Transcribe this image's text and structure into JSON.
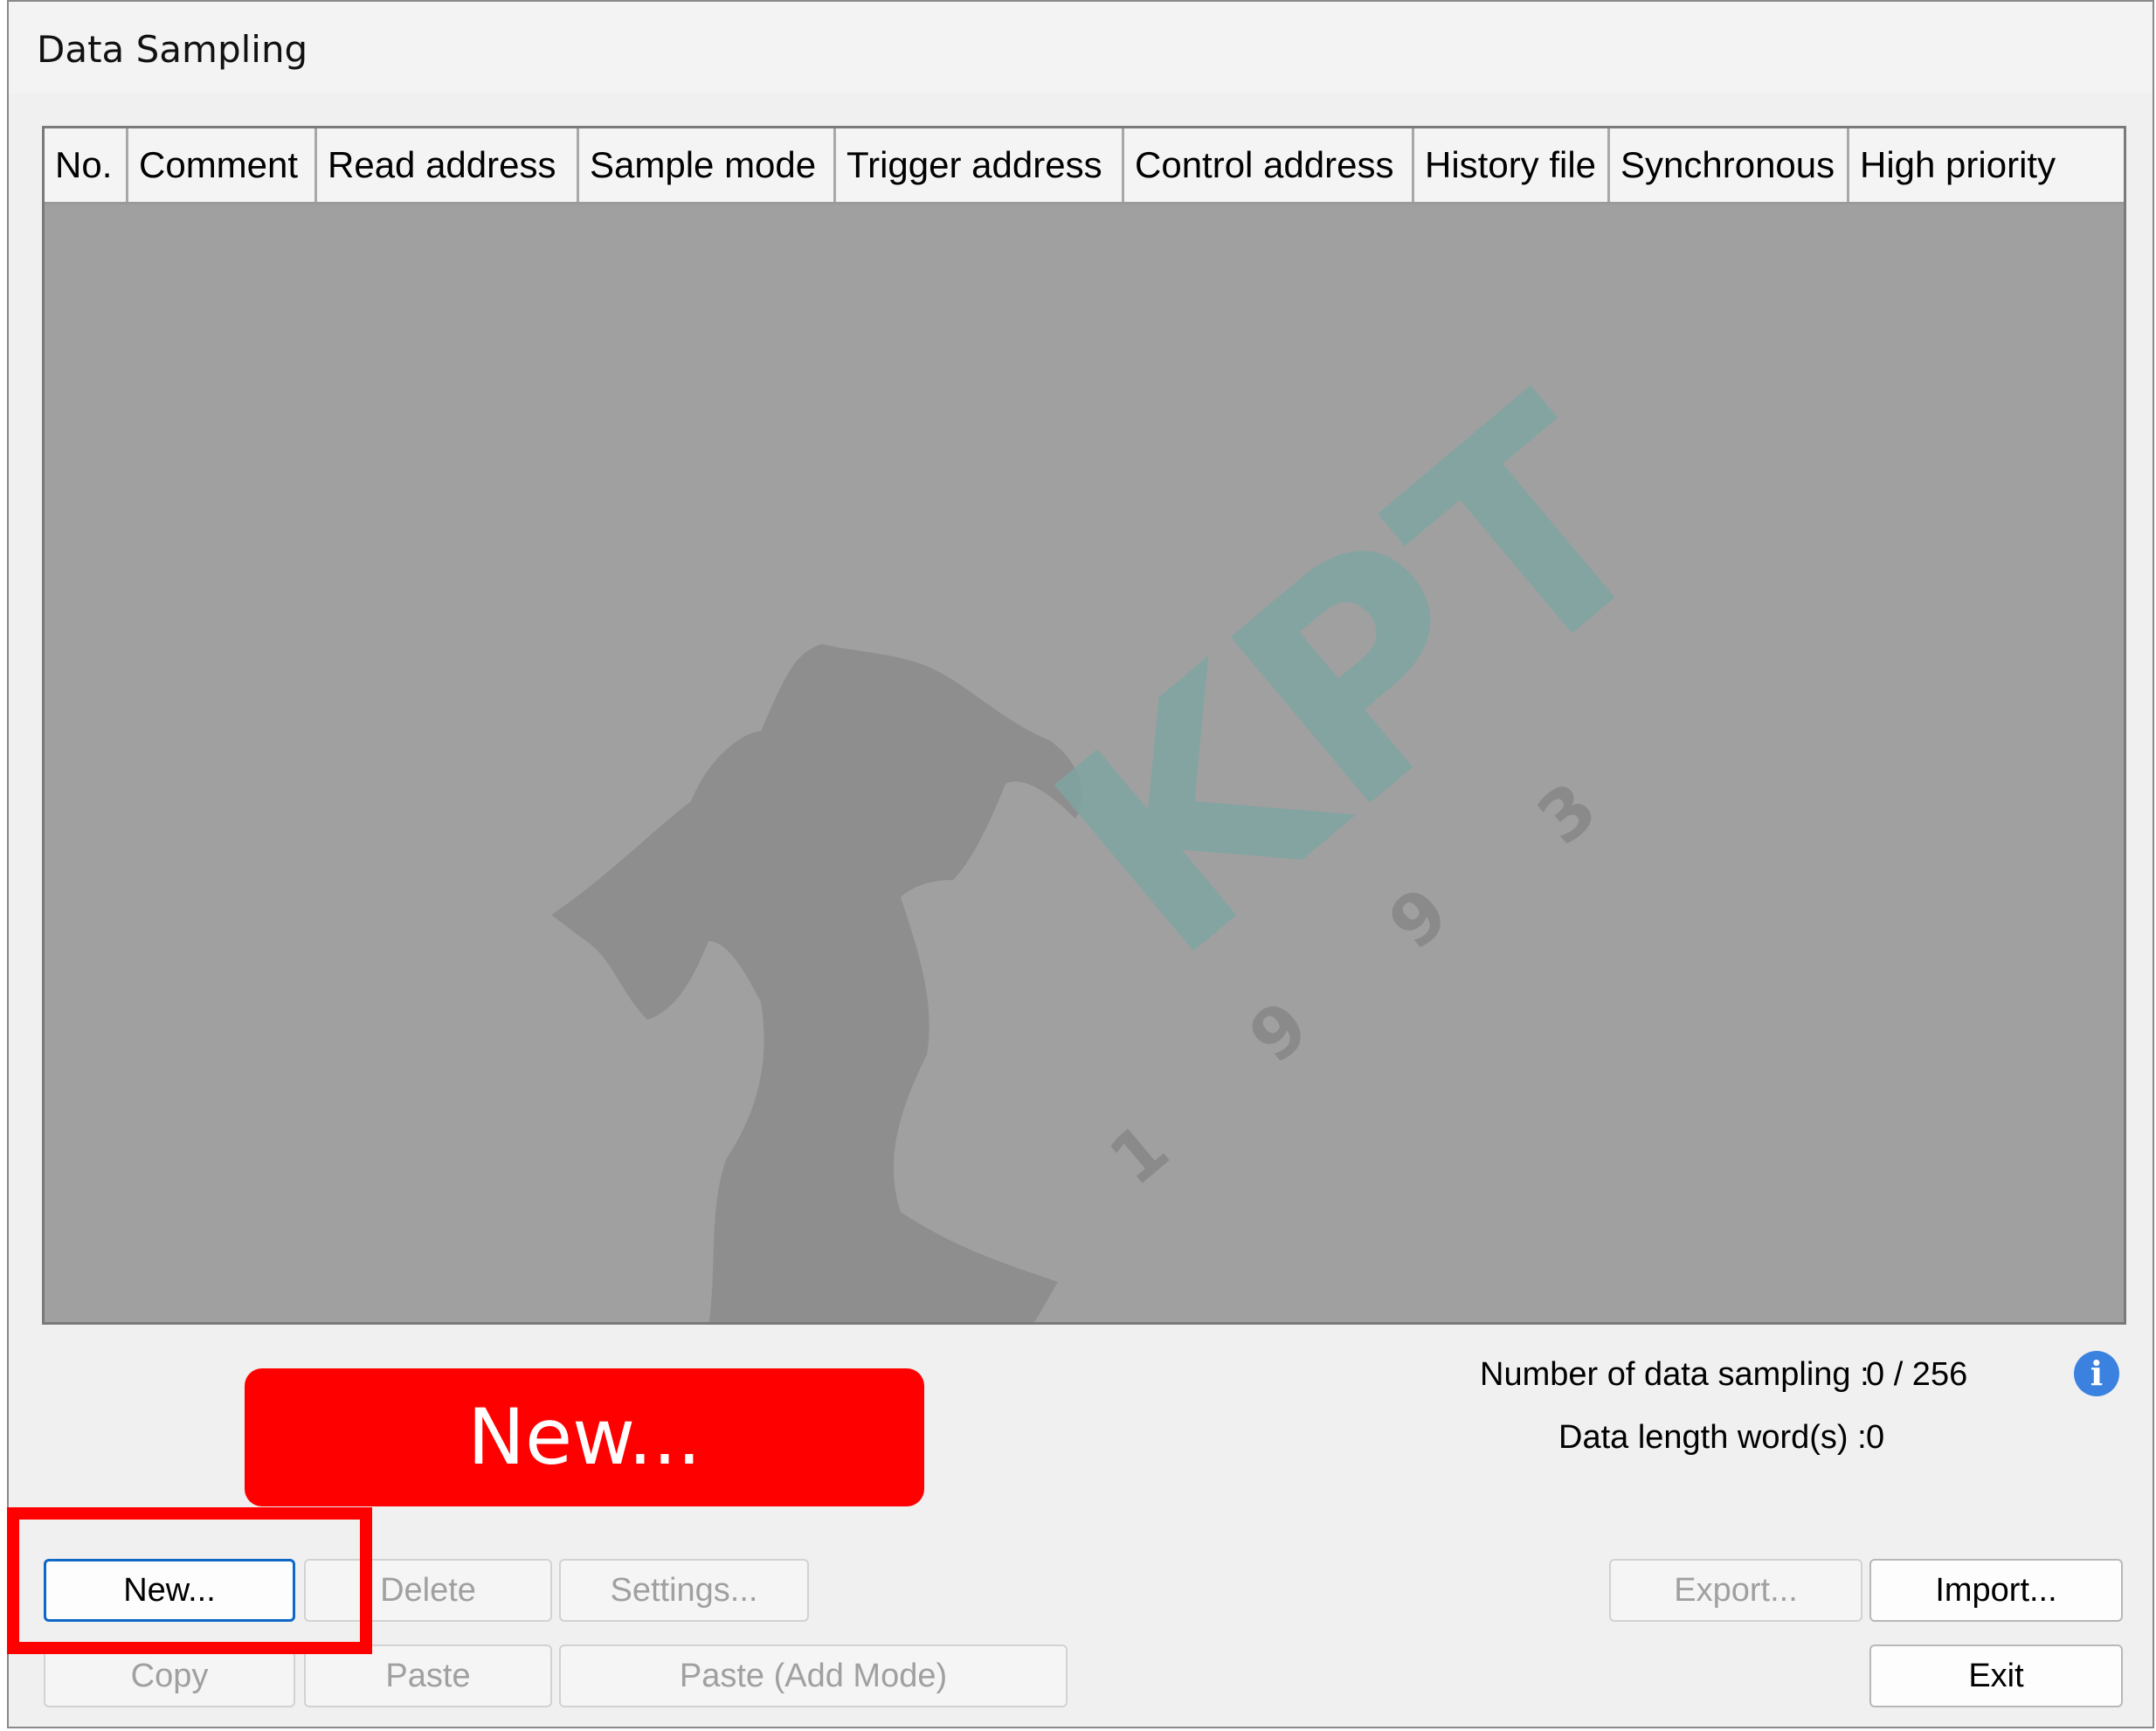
{
  "window": {
    "title": "Data Sampling"
  },
  "table": {
    "columns": [
      "No.",
      "Comment",
      "Read address",
      "Sample mode",
      "Trigger address",
      "Control address",
      "History file",
      "Synchronous",
      "High priority"
    ],
    "rows": []
  },
  "watermark": {
    "text": "KPT",
    "digits": [
      "1",
      "9",
      "9",
      "3"
    ]
  },
  "info": {
    "count_label": "Number of data sampling :",
    "count_value": "0 / 256",
    "length_label": "Data length word(s) :",
    "length_value": "0"
  },
  "buttons": {
    "new": "New...",
    "delete": "Delete",
    "settings": "Settings...",
    "copy": "Copy",
    "paste": "Paste",
    "paste_add": "Paste (Add Mode)",
    "export": "Export...",
    "import": "Import...",
    "exit": "Exit"
  },
  "annotation": {
    "callout_text": "New..."
  },
  "colors": {
    "callout": "#ff0000",
    "focus": "#0f67c6",
    "grid_bg": "#a0a0a0",
    "info_icon": "#3b82e0"
  },
  "icons": {
    "info": "info-icon"
  }
}
